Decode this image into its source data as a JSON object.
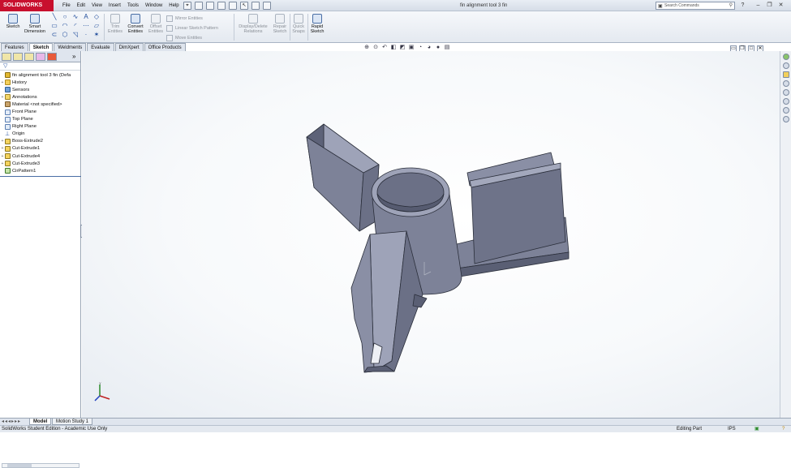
{
  "app": {
    "logo": "SOLIDWORKS",
    "window_title": "fin alignment tool 3 fin"
  },
  "menu": [
    "File",
    "Edit",
    "View",
    "Insert",
    "Tools",
    "Window",
    "Help"
  ],
  "search": {
    "placeholder": "Search Commands"
  },
  "ribbon": {
    "sketch": "Sketch",
    "smart_dimension": "Smart Dimension",
    "trim": "Trim Entities",
    "convert": "Convert Entities",
    "offset": "Offset Entities",
    "mirror": "Mirror Entities",
    "linear_pattern": "Linear Sketch Pattern",
    "move": "Move Entities",
    "display_delete": "Display/Delete Relations",
    "repair": "Repair Sketch",
    "quick_snaps": "Quick Snaps",
    "rapid_sketch": "Rapid Sketch"
  },
  "command_tabs": [
    "Features",
    "Sketch",
    "Weldments",
    "Evaluate",
    "DimXpert",
    "Office Products"
  ],
  "active_command_tab": "Sketch",
  "tree": {
    "root": "fin alignment tool 3 fin  (Defa",
    "items": [
      {
        "label": "History",
        "icon": "history-folder-icon"
      },
      {
        "label": "Sensors",
        "icon": "sensor-icon"
      },
      {
        "label": "Annotations",
        "icon": "annotations-icon"
      },
      {
        "label": "Material <not specified>",
        "icon": "material-icon"
      },
      {
        "label": "Front Plane",
        "icon": "plane-icon"
      },
      {
        "label": "Top Plane",
        "icon": "plane-icon"
      },
      {
        "label": "Right Plane",
        "icon": "plane-icon"
      },
      {
        "label": "Origin",
        "icon": "origin-icon"
      },
      {
        "label": "Boss-Extrude2",
        "icon": "boss-extrude-icon"
      },
      {
        "label": "Cut-Extrude1",
        "icon": "cut-extrude-icon"
      },
      {
        "label": "Cut-Extrude4",
        "icon": "cut-extrude-icon"
      },
      {
        "label": "Cut-Extrude3",
        "icon": "cut-extrude-icon"
      },
      {
        "label": "CirPattern1",
        "icon": "circular-pattern-icon"
      }
    ]
  },
  "bottom_tabs": [
    "Model",
    "Motion Study 1"
  ],
  "status": {
    "edition": "SolidWorks Student Edition - Academic Use Only",
    "mode": "Editing Part",
    "units": "IPS",
    "help": "?"
  }
}
